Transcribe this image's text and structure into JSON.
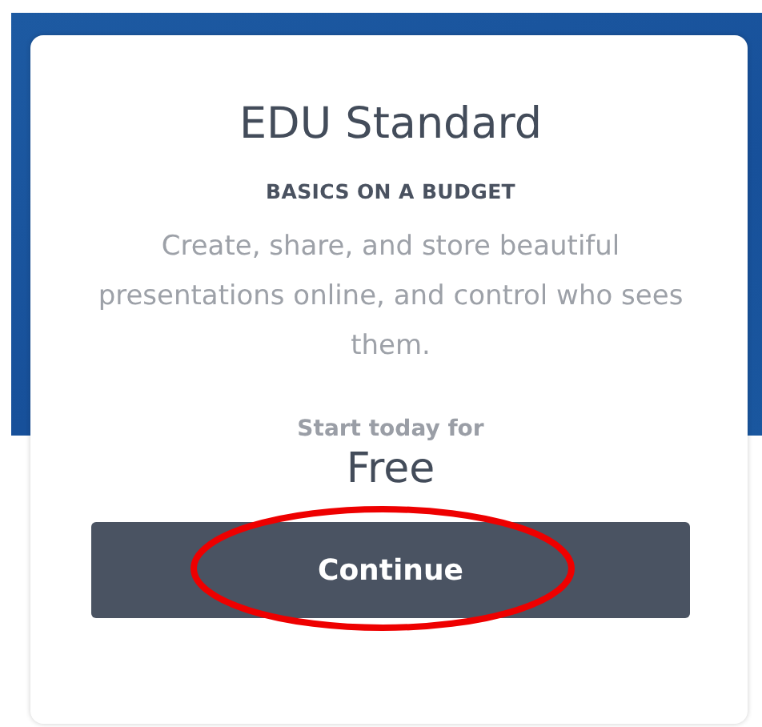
{
  "plan": {
    "title": "EDU Standard",
    "tagline": "BASICS ON A BUDGET",
    "description": "Create, share, and store beautiful presentations online, and control who sees them.",
    "price_label": "Start today for",
    "price": "Free",
    "button": "Continue",
    "highlighted": true
  }
}
